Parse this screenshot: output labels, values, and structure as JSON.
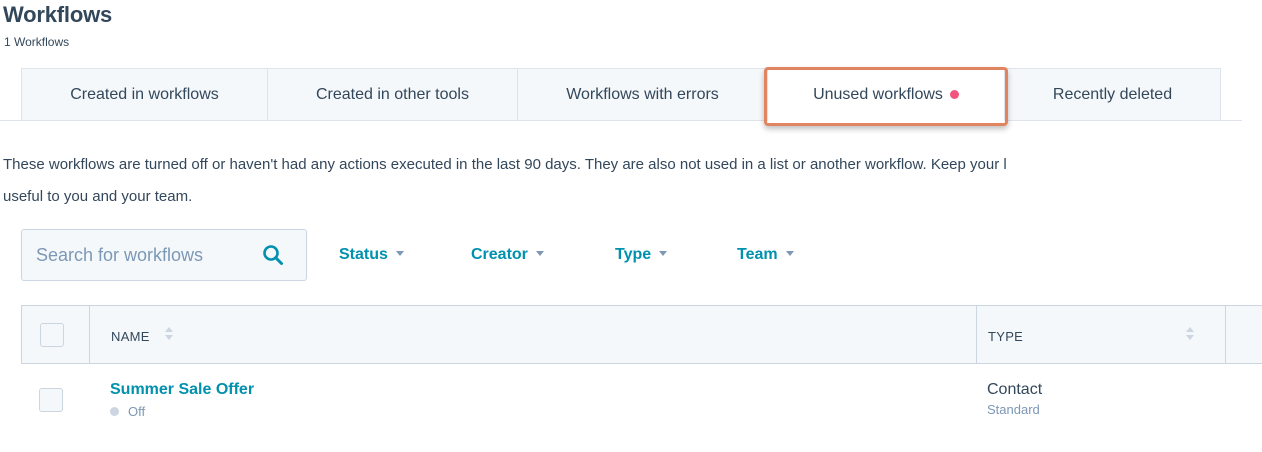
{
  "header": {
    "title": "Workflows",
    "count": "1 Workflows"
  },
  "tabs": [
    {
      "label": "Created in workflows",
      "active": false
    },
    {
      "label": "Created in other tools",
      "active": false
    },
    {
      "label": "Workflows with errors",
      "active": false
    },
    {
      "label": "Unused workflows",
      "active": true,
      "has_dot": true
    },
    {
      "label": "Recently deleted",
      "active": false
    }
  ],
  "description": "These workflows are turned off or haven't had any actions executed in the last 90 days. They are also not used in a list or another workflow. Keep your l",
  "description_line2": "useful to you and your team.",
  "search": {
    "placeholder": "Search for workflows",
    "icon": "search-icon"
  },
  "filters": [
    {
      "label": "Status"
    },
    {
      "label": "Creator"
    },
    {
      "label": "Type"
    },
    {
      "label": "Team"
    }
  ],
  "table": {
    "columns": [
      {
        "label": "NAME",
        "sortable": true
      },
      {
        "label": "TYPE",
        "sortable": true
      }
    ],
    "rows": [
      {
        "name": "Summer Sale Offer",
        "status": "Off",
        "type": "Contact",
        "subtype": "Standard"
      }
    ]
  },
  "colors": {
    "text": "#33475b",
    "link": "#0091ae",
    "muted": "#7c98b6",
    "border": "#cbd6e2",
    "tab_bg": "#f5f8fa",
    "notification_dot": "#f2547d",
    "highlight_border": "#e0855f"
  }
}
